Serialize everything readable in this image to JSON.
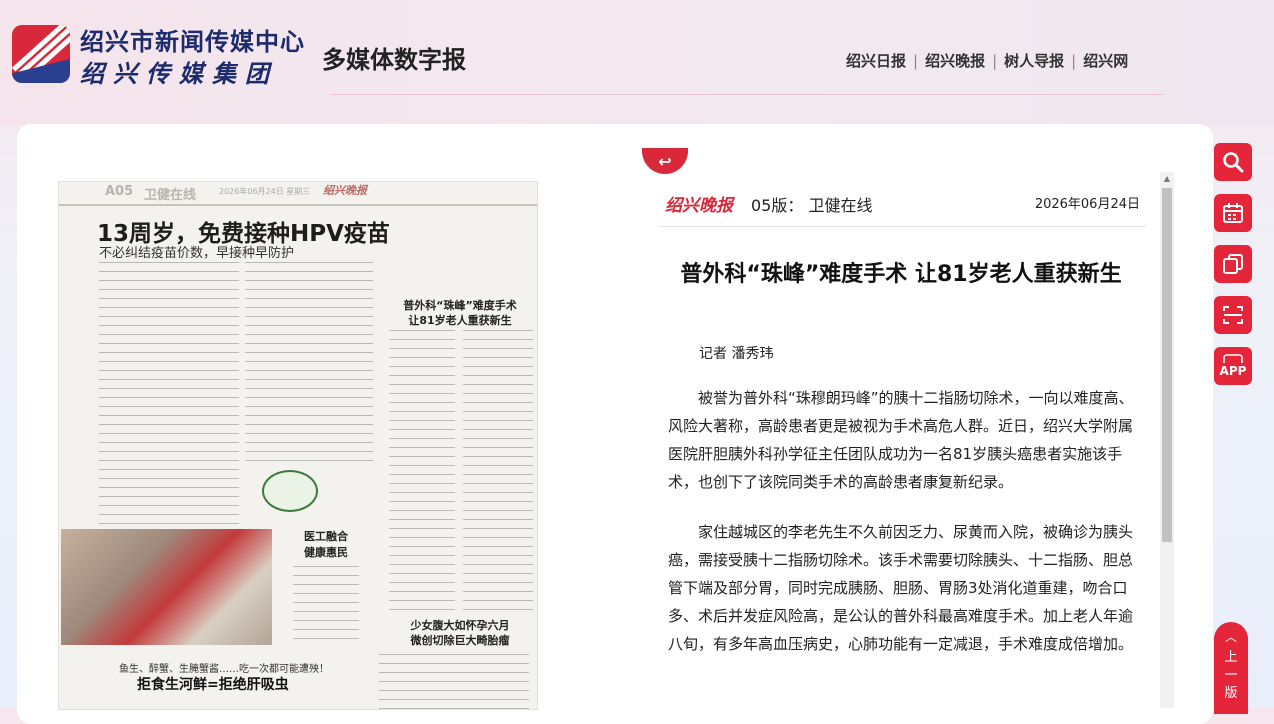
{
  "header": {
    "org_name": "绍兴市新闻传媒中心",
    "group_name": "绍兴传媒集团",
    "site_title": "多媒体数字报",
    "links": [
      "绍兴日报",
      "绍兴晚报",
      "树人导报",
      "绍兴网"
    ],
    "separator": "|"
  },
  "paper": {
    "page_no": "A05",
    "section": "卫健在线",
    "date_line": "2026年06月24日  星期三",
    "logo": "绍兴晚报",
    "headline": "13周岁，免费接种HPV疫苗",
    "subheadline": "不必纠结疫苗价数，早接种早防护",
    "article_title": "普外科“珠峰”难度手术\n让81岁老人重获新生",
    "article2_title": "医工融合\n健康惠民",
    "article3_title": "少女腹大如怀孕六月\n微创切除巨大畸胎瘤",
    "bottom_sub": "鱼生、醉蟹、生腌蟹酱……吃一次都可能遭殃！",
    "bottom_title": "拒食生河鲜=拒绝肝吸虫"
  },
  "article": {
    "logo": "绍兴晚报",
    "edition": "05版：  卫健在线",
    "date": "2026年06月24日",
    "title": "普外科“珠峰”难度手术 让81岁老人重获新生",
    "author": "记者 潘秀玮",
    "paragraphs": [
      "被誉为普外科“珠穆朗玛峰”的胰十二指肠切除术，一向以难度高、风险大著称，高龄患者更是被视为手术高危人群。近日，绍兴大学附属医院肝胆胰外科孙学征主任团队成功为一名81岁胰头癌患者实施该手术，也创下了该院同类手术的高龄患者康复新纪录。",
      "家住越城区的李老先生不久前因乏力、尿黄而入院，被确诊为胰头癌，需接受胰十二指肠切除术。该手术需要切除胰头、十二指肠、胆总管下端及部分胃，同时完成胰肠、胆肠、胃肠3处消化道重建，吻合口多、术后并发症风险高，是公认的普外科最高难度手术。加上老人年逾八旬，有多年高血压病史，心肺功能有一定减退，手术难度成倍增加。"
    ]
  },
  "tools": {
    "app_label": "APP",
    "prev_page": "上一版"
  },
  "colors": {
    "accent": "#e4253a",
    "brand_blue": "#1c2b6b"
  }
}
